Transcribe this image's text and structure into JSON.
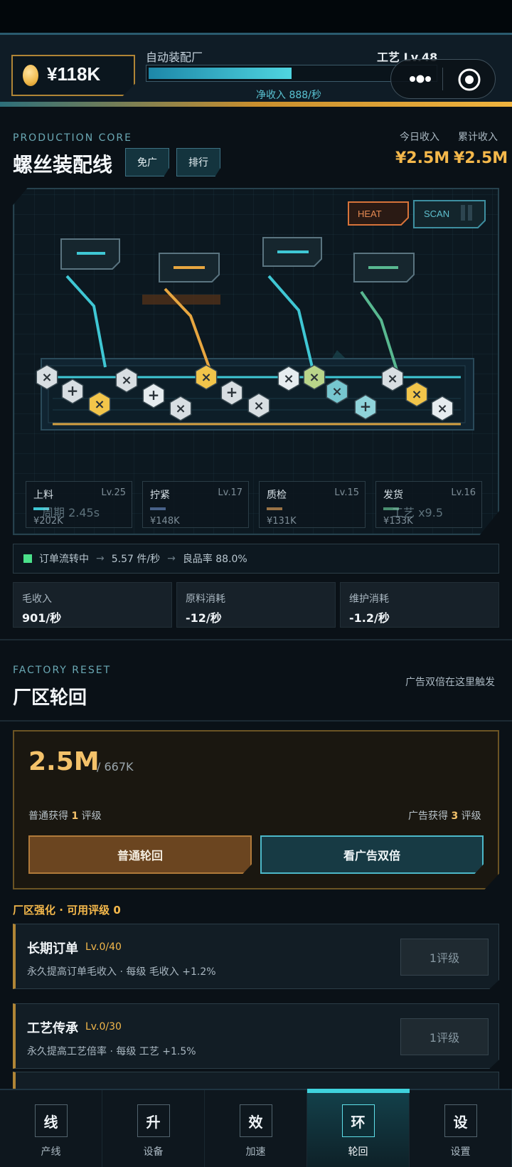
{
  "header": {
    "coin_amount": "¥118K",
    "factory_name": "自动装配厂",
    "craft_level": "工艺 Lv.48",
    "progress": 0.5,
    "net_income": "净收入 888/秒"
  },
  "production": {
    "section_label": "PRODUCTION CORE",
    "line_title": "螺丝装配线",
    "btn_noad": "免广",
    "btn_rank": "排行",
    "today_label": "今日收入",
    "total_label": "累计收入",
    "today_value": "¥2.5M",
    "total_value": "¥2.5M",
    "mode_heat": "HEAT",
    "mode_scan": "SCAN",
    "stations": [
      {
        "name": "上料",
        "level": "Lv.25",
        "value": "¥202K",
        "overlay": "周期 2.45s",
        "color": "#3fc7d4"
      },
      {
        "name": "拧紧",
        "level": "Lv.17",
        "value": "¥148K",
        "overlay": "",
        "color": "#48628a"
      },
      {
        "name": "质检",
        "level": "Lv.15",
        "value": "¥131K",
        "overlay": "",
        "color": "#9a7346"
      },
      {
        "name": "发货",
        "level": "Lv.16",
        "value": "¥133K",
        "overlay": "工艺 x9.5",
        "color": "#4a8f70"
      }
    ],
    "flow_status": "订单流转中",
    "flow_rate": "5.57 件/秒",
    "flow_quality": "良品率 88.0%",
    "stats": [
      {
        "label": "毛收入",
        "value": "901/秒"
      },
      {
        "label": "原料消耗",
        "value": "-12/秒"
      },
      {
        "label": "维护消耗",
        "value": "-1.2/秒"
      }
    ]
  },
  "reset": {
    "section_label": "FACTORY RESET",
    "title": "厂区轮回",
    "hint": "广告双倍在这里触发",
    "current": "2.5M",
    "required": "/ 667K",
    "normal_gain_prefix": "普通获得",
    "normal_gain_num": "1",
    "normal_gain_suffix": "评级",
    "ad_gain_prefix": "广告获得",
    "ad_gain_num": "3",
    "ad_gain_suffix": "评级",
    "btn_normal": "普通轮回",
    "btn_ad": "看广告双倍"
  },
  "enhance": {
    "title": "厂区强化 · 可用评级 0",
    "items": [
      {
        "name": "长期订单",
        "level": "Lv.0/40",
        "desc": "永久提高订单毛收入 · 每级 毛收入 +1.2%",
        "cost": "1评级"
      },
      {
        "name": "工艺传承",
        "level": "Lv.0/30",
        "desc": "永久提高工艺倍率 · 每级 工艺 +1.5%",
        "cost": "1评级"
      }
    ]
  },
  "nav": [
    {
      "glyph": "线",
      "label": "产线"
    },
    {
      "glyph": "升",
      "label": "设备"
    },
    {
      "glyph": "效",
      "label": "加速"
    },
    {
      "glyph": "环",
      "label": "轮回"
    },
    {
      "glyph": "设",
      "label": "设置"
    }
  ],
  "active_nav": 3
}
